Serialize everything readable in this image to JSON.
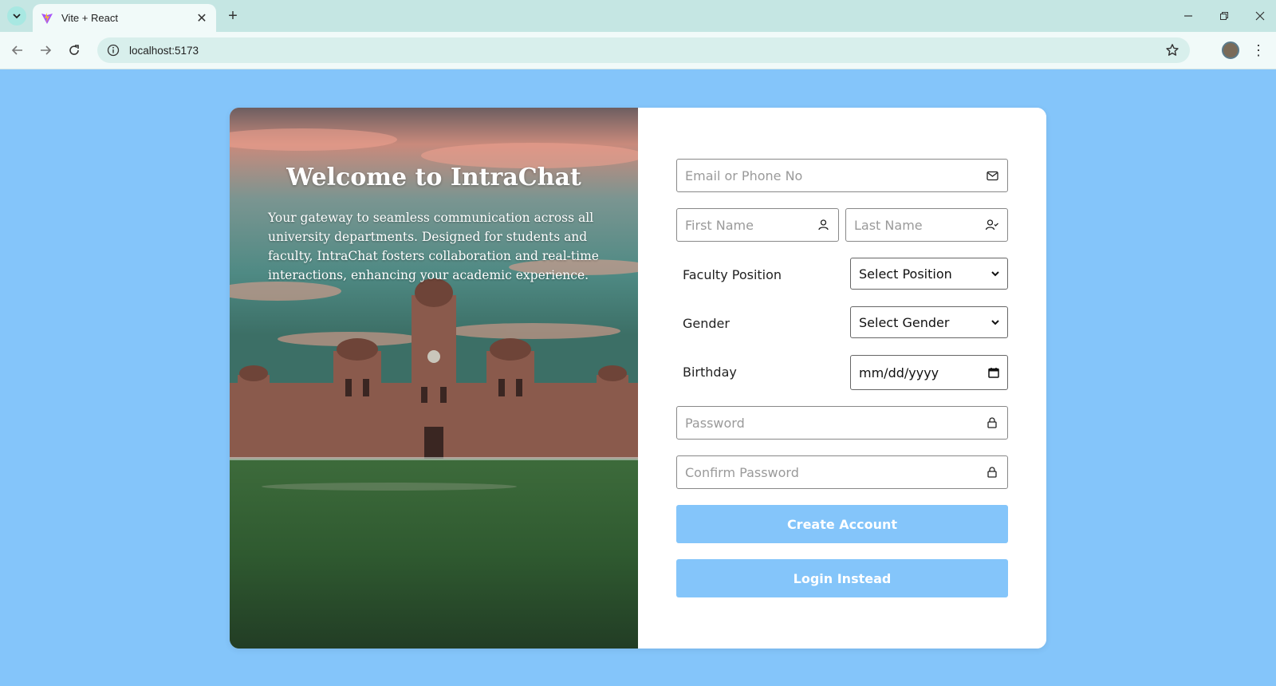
{
  "browser": {
    "tab_title": "Vite + React",
    "url": "localhost:5173",
    "new_tab_symbol": "+",
    "close_symbol": "✕",
    "menu_symbol": "⋮"
  },
  "hero": {
    "title": "Welcome to IntraChat",
    "description": "Your gateway to seamless communication across all university departments. Designed for students and faculty, IntraChat fosters collaboration and real-time interactions, enhancing your academic experience."
  },
  "form": {
    "email_placeholder": "Email or Phone No",
    "first_name_placeholder": "First Name",
    "last_name_placeholder": "Last Name",
    "faculty_label": "Faculty Position",
    "faculty_select": "Select Position",
    "gender_label": "Gender",
    "gender_select": "Select Gender",
    "birthday_label": "Birthday",
    "birthday_placeholder": "mm/dd/yyyy",
    "password_placeholder": "Password",
    "confirm_password_placeholder": "Confirm Password",
    "create_button": "Create Account",
    "login_button": "Login Instead"
  },
  "colors": {
    "page_background": "#84c5fa",
    "button_background": "#84c5fa",
    "card_background": "#ffffff"
  }
}
